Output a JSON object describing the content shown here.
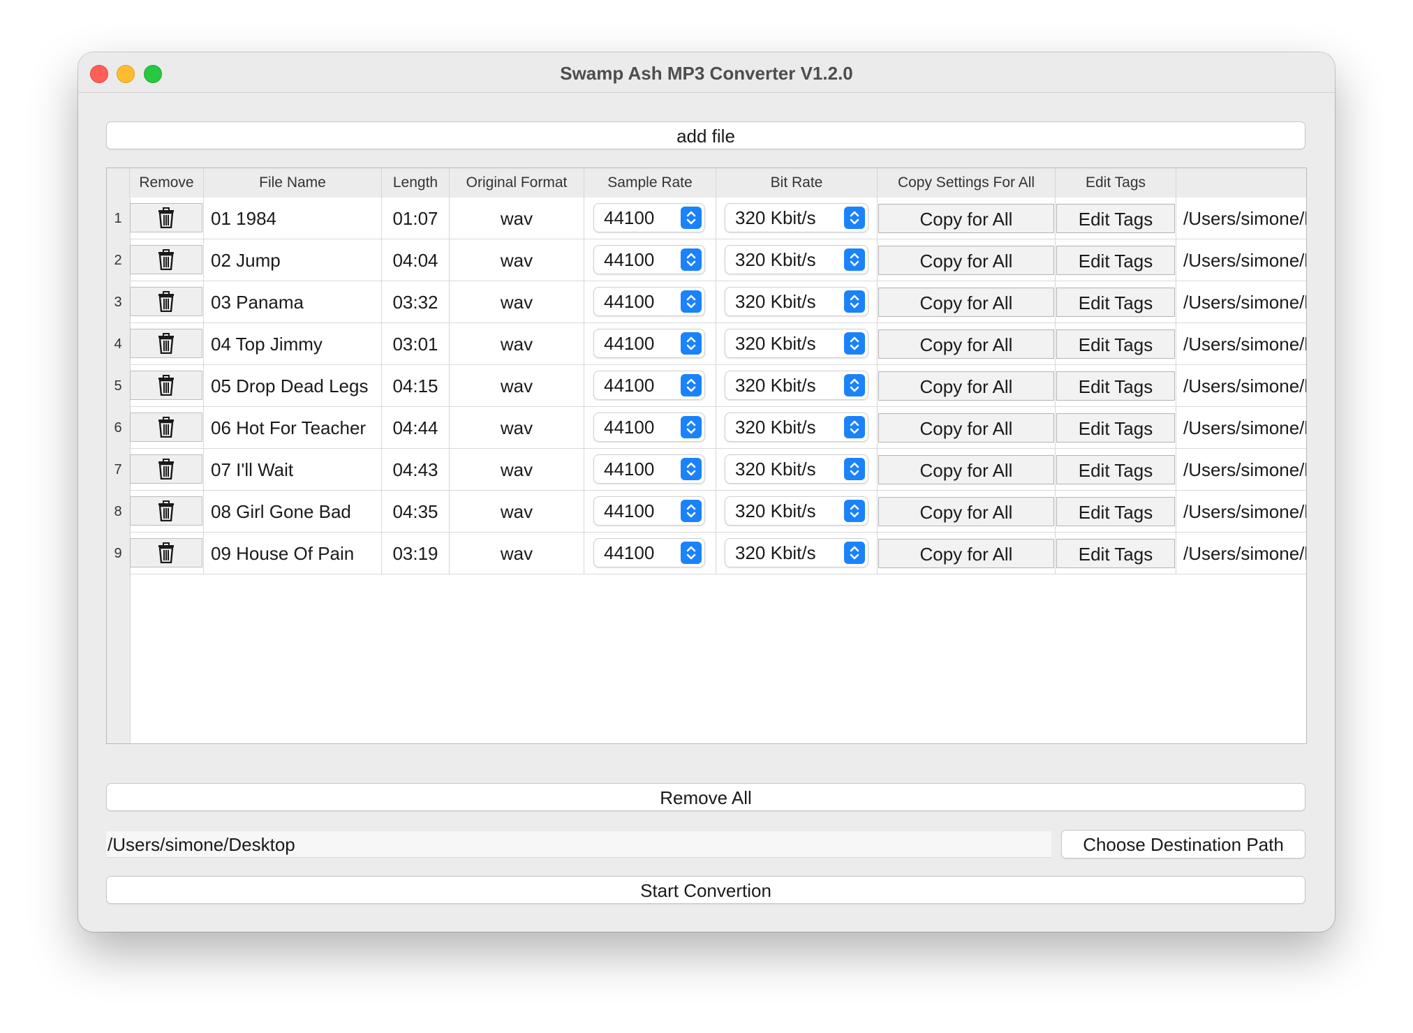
{
  "window": {
    "title": "Swamp Ash MP3 Converter V1.2.0"
  },
  "buttons": {
    "add_file": "add file",
    "remove_all": "Remove All",
    "choose_destination": "Choose Destination Path",
    "start_conversion": "Start Convertion"
  },
  "destination": {
    "path": "/Users/simone/Desktop"
  },
  "table": {
    "headers": [
      "Remove",
      "File Name",
      "Length",
      "Original Format",
      "Sample Rate",
      "Bit Rate",
      "Copy Settings For All",
      "Edit Tags",
      ""
    ],
    "rows": [
      {
        "num": "1",
        "name": "01 1984",
        "length": "01:07",
        "format": "wav",
        "sample_rate": "44100",
        "bit_rate": "320 Kbit/s",
        "copy": "Copy for All",
        "edit": "Edit Tags",
        "path": "/Users/simone/l"
      },
      {
        "num": "2",
        "name": "02 Jump",
        "length": "04:04",
        "format": "wav",
        "sample_rate": "44100",
        "bit_rate": "320 Kbit/s",
        "copy": "Copy for All",
        "edit": "Edit Tags",
        "path": "/Users/simone/l"
      },
      {
        "num": "3",
        "name": "03 Panama",
        "length": "03:32",
        "format": "wav",
        "sample_rate": "44100",
        "bit_rate": "320 Kbit/s",
        "copy": "Copy for All",
        "edit": "Edit Tags",
        "path": "/Users/simone/l"
      },
      {
        "num": "4",
        "name": "04 Top Jimmy",
        "length": "03:01",
        "format": "wav",
        "sample_rate": "44100",
        "bit_rate": "320 Kbit/s",
        "copy": "Copy for All",
        "edit": "Edit Tags",
        "path": "/Users/simone/l"
      },
      {
        "num": "5",
        "name": "05 Drop Dead Legs",
        "length": "04:15",
        "format": "wav",
        "sample_rate": "44100",
        "bit_rate": "320 Kbit/s",
        "copy": "Copy for All",
        "edit": "Edit Tags",
        "path": "/Users/simone/l"
      },
      {
        "num": "6",
        "name": "06 Hot For Teacher",
        "length": "04:44",
        "format": "wav",
        "sample_rate": "44100",
        "bit_rate": "320 Kbit/s",
        "copy": "Copy for All",
        "edit": "Edit Tags",
        "path": "/Users/simone/l"
      },
      {
        "num": "7",
        "name": "07 I'll Wait",
        "length": "04:43",
        "format": "wav",
        "sample_rate": "44100",
        "bit_rate": "320 Kbit/s",
        "copy": "Copy for All",
        "edit": "Edit Tags",
        "path": "/Users/simone/l"
      },
      {
        "num": "8",
        "name": "08 Girl Gone Bad",
        "length": "04:35",
        "format": "wav",
        "sample_rate": "44100",
        "bit_rate": "320 Kbit/s",
        "copy": "Copy for All",
        "edit": "Edit Tags",
        "path": "/Users/simone/l"
      },
      {
        "num": "9",
        "name": "09 House Of Pain",
        "length": "03:19",
        "format": "wav",
        "sample_rate": "44100",
        "bit_rate": "320 Kbit/s",
        "copy": "Copy for All",
        "edit": "Edit Tags",
        "path": "/Users/simone/l"
      }
    ]
  },
  "icons": {
    "remove": "trash-icon",
    "popup": "up-down-chevron-icon"
  },
  "colors": {
    "accent": "#1a82fb",
    "close": "#fe5f57",
    "minimize": "#febc2e",
    "maximize": "#28c840"
  }
}
